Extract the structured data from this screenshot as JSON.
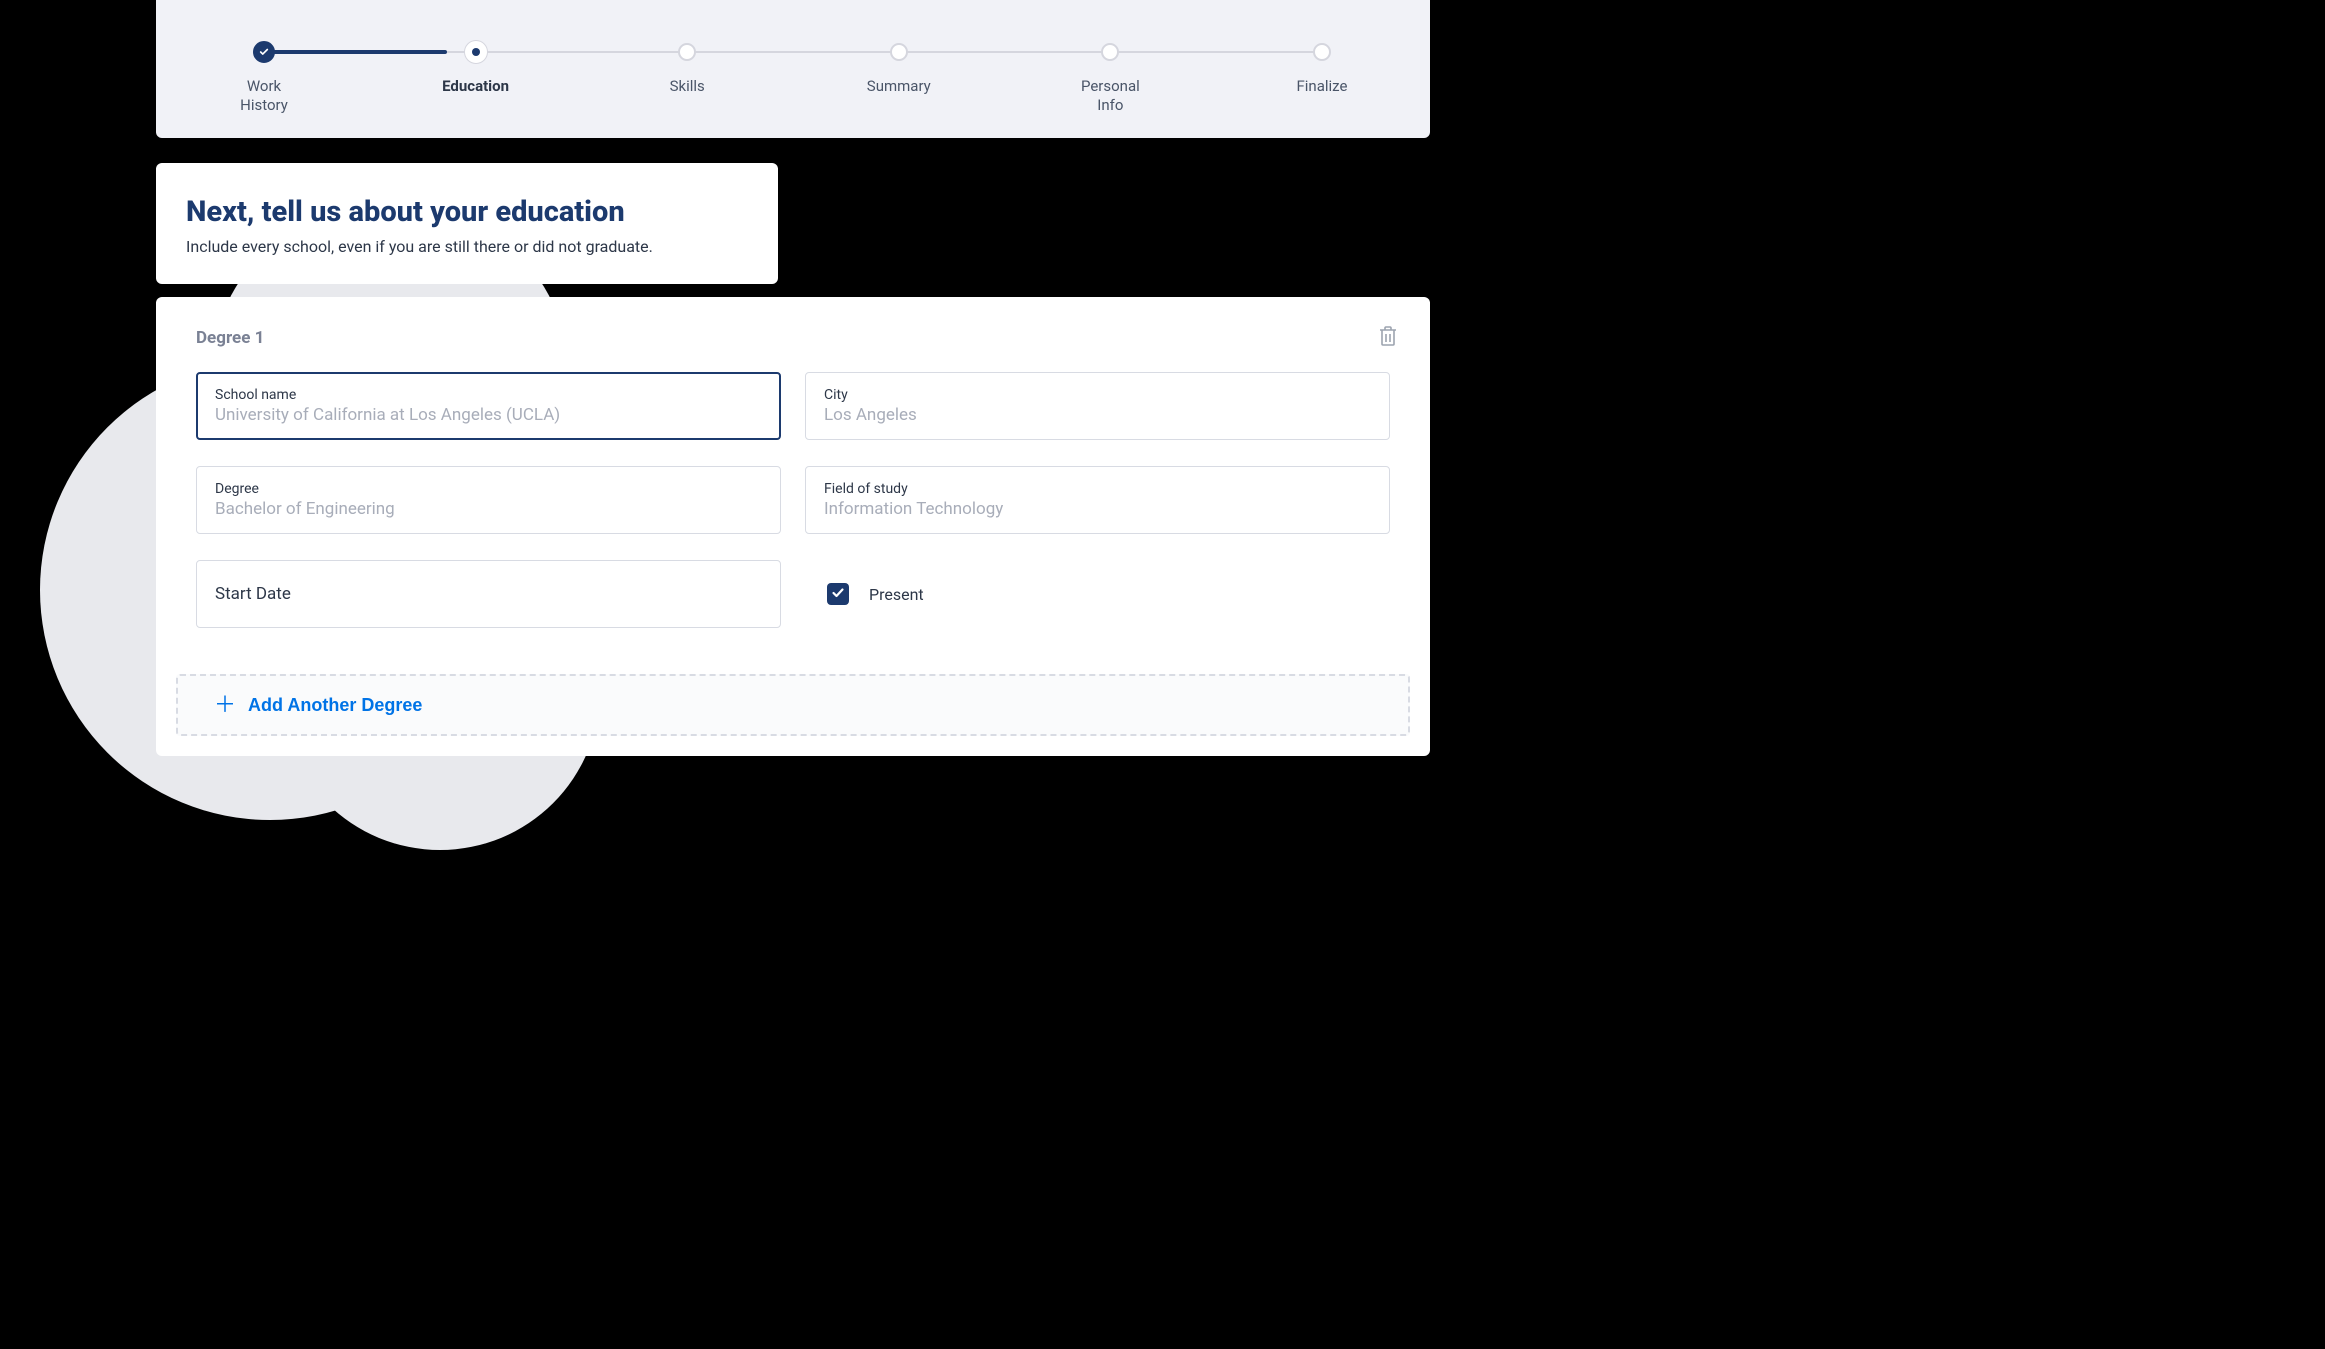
{
  "stepper": {
    "steps": [
      {
        "label": "Work\nHistory",
        "state": "done"
      },
      {
        "label": "Education",
        "state": "active"
      },
      {
        "label": "Skills",
        "state": "pending"
      },
      {
        "label": "Summary",
        "state": "pending"
      },
      {
        "label": "Personal\nInfo",
        "state": "pending"
      },
      {
        "label": "Finalize",
        "state": "pending"
      }
    ]
  },
  "header": {
    "title": "Next, tell us about your education",
    "subtitle": "Include every school, even if you are still there or did not graduate."
  },
  "degree": {
    "title": "Degree 1",
    "fields": {
      "school": {
        "label": "School name",
        "placeholder": "University of California at Los Angeles (UCLA)",
        "value": ""
      },
      "city": {
        "label": "City",
        "placeholder": "Los Angeles",
        "value": ""
      },
      "degree": {
        "label": "Degree",
        "placeholder": "Bachelor of Engineering",
        "value": ""
      },
      "field_of_study": {
        "label": "Field of study",
        "placeholder": "Information Technology",
        "value": ""
      },
      "start_date": {
        "label": "Start Date"
      },
      "present": {
        "label": "Present",
        "checked": true
      }
    }
  },
  "actions": {
    "add_another": "Add Another Degree"
  }
}
